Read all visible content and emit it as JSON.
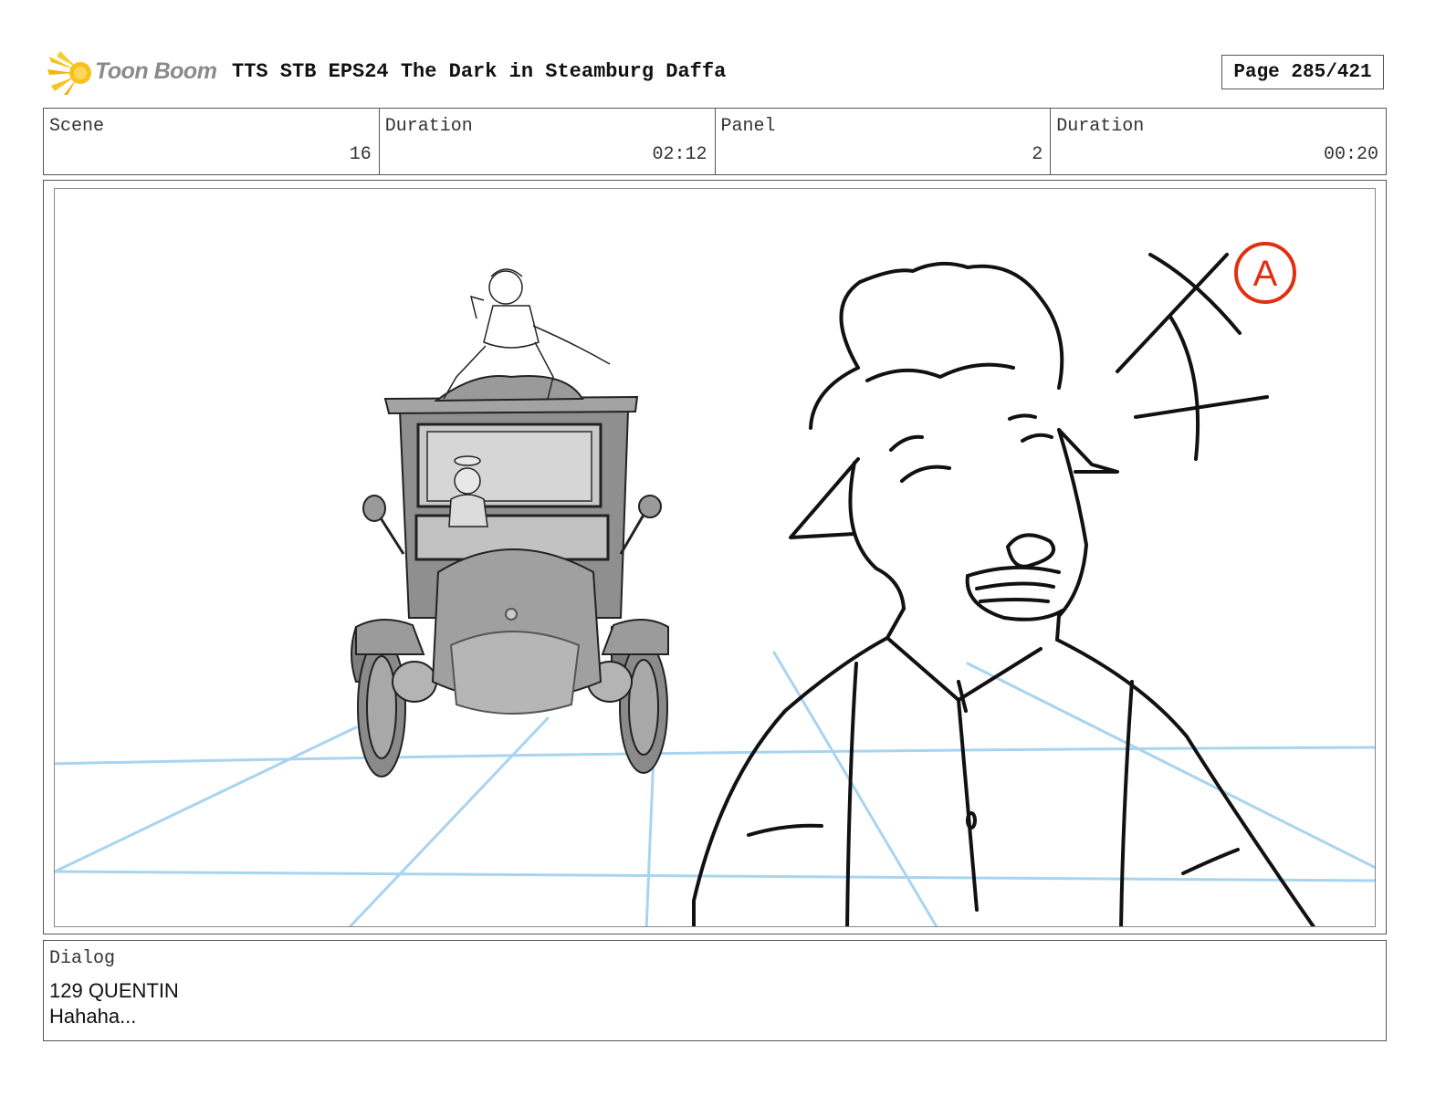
{
  "header": {
    "logo_text": "Toon Boom",
    "document_title": "TTS STB EPS24 The Dark in Steamburg Daffa",
    "page_label": "Page 285/421"
  },
  "info": {
    "scene_label": "Scene",
    "scene_value": "16",
    "scene_duration_label": "Duration",
    "scene_duration_value": "02:12",
    "panel_label": "Panel",
    "panel_value": "2",
    "panel_duration_label": "Duration",
    "panel_duration_value": "00:20"
  },
  "panel": {
    "annotation_letter": "A",
    "colors": {
      "guide_lines": "#a8d4f0",
      "sketch": "#111111",
      "annotation": "#e03010",
      "car_body": "#8f8f8f"
    }
  },
  "dialog": {
    "label": "Dialog",
    "line1": "129 QUENTIN",
    "line2": "Hahaha..."
  }
}
